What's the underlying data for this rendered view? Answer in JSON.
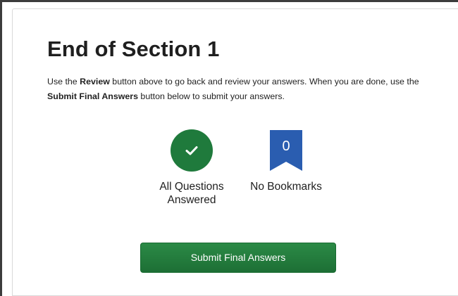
{
  "page": {
    "title": "End of Section 1"
  },
  "instructions": {
    "part1": "Use the ",
    "review_label": "Review",
    "part2": " button above to go back and review your answers. When you are done, use the ",
    "submit_label": "Submit Final Answers",
    "part3": " button below to submit your answers."
  },
  "status": {
    "answered": {
      "icon": "check-icon",
      "color": "#1f7a3c",
      "label_line1": "All Questions",
      "label_line2": "Answered"
    },
    "bookmarks": {
      "icon": "bookmark-icon",
      "color": "#2a5db0",
      "count": "0",
      "label": "No Bookmarks"
    }
  },
  "actions": {
    "submit_button_label": "Submit Final Answers",
    "submit_button_color": "#1f7a3c"
  }
}
